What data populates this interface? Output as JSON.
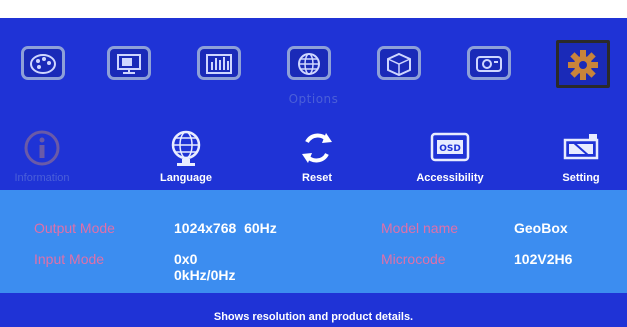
{
  "top_tabs": [
    {
      "icon": "palette-icon"
    },
    {
      "icon": "monitor-icon"
    },
    {
      "icon": "equalizer-icon"
    },
    {
      "icon": "globe-grid-icon"
    },
    {
      "icon": "3d-cube-icon"
    },
    {
      "icon": "projector-icon"
    },
    {
      "icon": "gear-icon",
      "selected": true
    }
  ],
  "section_title": "Options",
  "menu_items": [
    {
      "label": "Information",
      "icon": "info-icon",
      "active": false
    },
    {
      "label": "Language",
      "icon": "globe-icon",
      "active": true
    },
    {
      "label": "Reset",
      "icon": "reset-icon",
      "active": true
    },
    {
      "label": "Accessibility",
      "icon": "osd-icon",
      "active": true
    },
    {
      "label": "Setting",
      "icon": "setting-icon",
      "active": true
    }
  ],
  "info": {
    "output_mode_label": "Output Mode",
    "output_mode_value": "1024x768  60Hz",
    "input_mode_label": "Input Mode",
    "input_mode_value_line1": "0x0",
    "input_mode_value_line2": "0kHz/0Hz",
    "model_name_label": "Model name",
    "model_name_value": "GeoBox",
    "microcode_label": "Microcode",
    "microcode_value": "102V2H6"
  },
  "footer_hint": "Shows resolution and product details.",
  "colors": {
    "background": "#1f33d6",
    "panel": "#3c8df0",
    "label": "#e070a8",
    "dim": "#4b5fd8"
  }
}
